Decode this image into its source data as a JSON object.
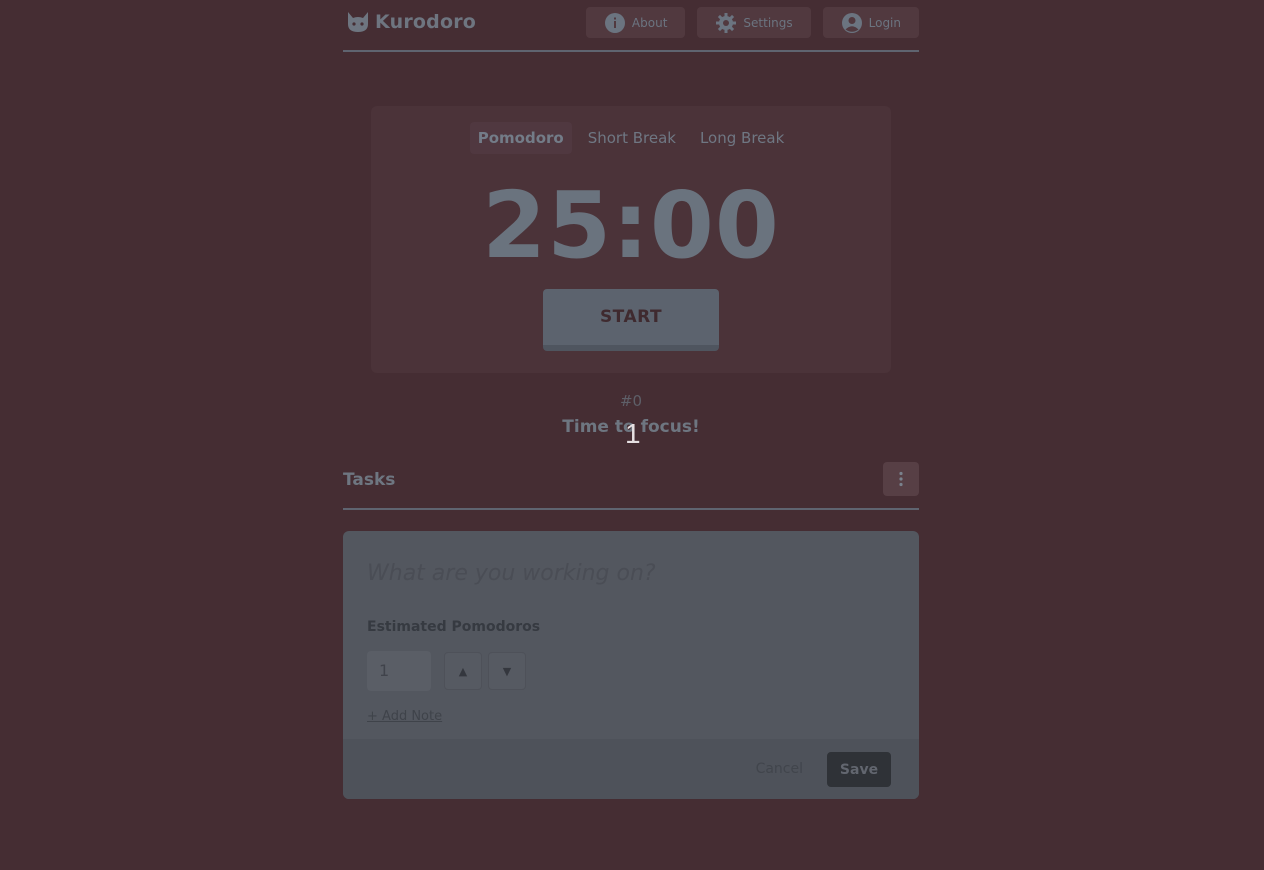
{
  "app": {
    "title": "Kurodoro"
  },
  "nav": {
    "about": "About",
    "settings": "Settings",
    "login": "Login"
  },
  "timer": {
    "tabs": [
      "Pomodoro",
      "Short Break",
      "Long Break"
    ],
    "active_tab": "Pomodoro",
    "time": "25:00",
    "start_label": "START"
  },
  "session": {
    "count": "#0",
    "message": "Time to focus!",
    "overlay_number": "1"
  },
  "tasks": {
    "title": "Tasks",
    "form": {
      "placeholder": "What are you working on?",
      "estimate_label": "Estimated Pomodoros",
      "estimate_value": "1",
      "increment_label": "▲",
      "decrement_label": "▼",
      "add_note": "+ Add Note",
      "cancel_label": "Cancel",
      "save_label": "Save"
    }
  },
  "colors": {
    "background": "#452d33",
    "card": "#4b3339",
    "task_card": "#53575f",
    "save_button": "#2f3237"
  },
  "icons": {
    "logo": "cat-icon",
    "about": "info-icon",
    "settings": "gear-icon",
    "login": "user-circle-icon",
    "task_menu": "kebab-menu-icon"
  }
}
